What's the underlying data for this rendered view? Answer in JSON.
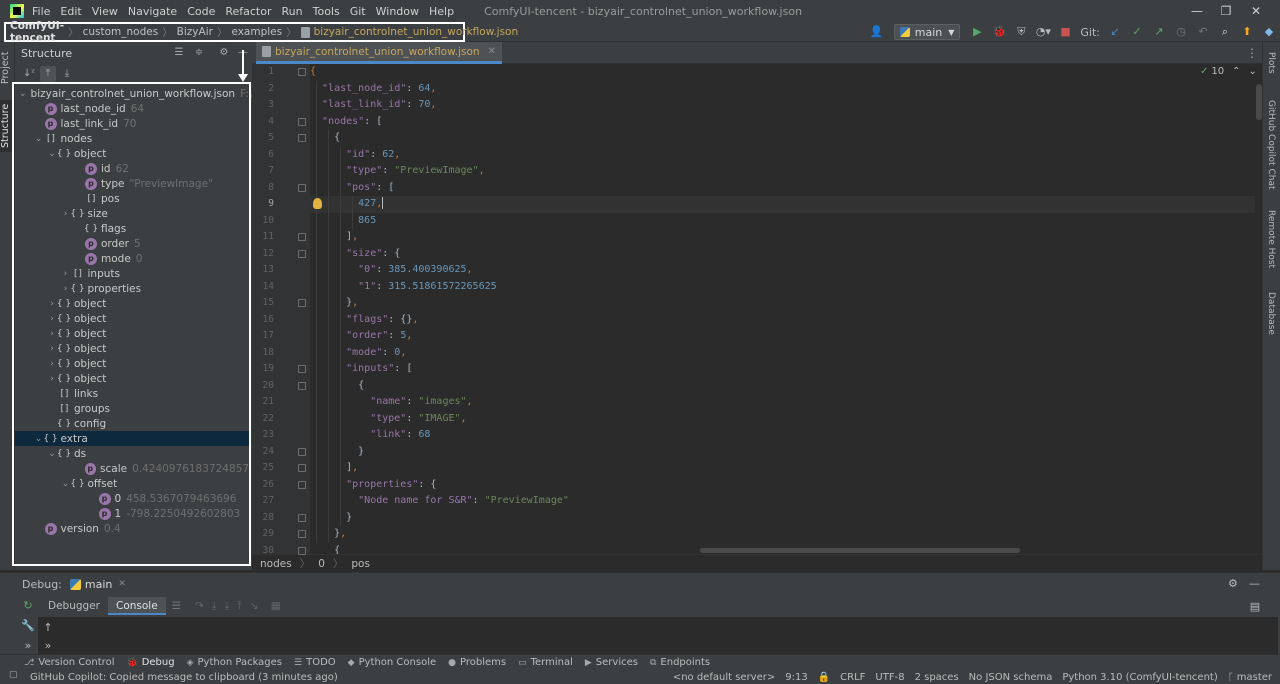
{
  "menu": [
    "File",
    "Edit",
    "View",
    "Navigate",
    "Code",
    "Refactor",
    "Run",
    "Tools",
    "Git",
    "Window",
    "Help"
  ],
  "window_title": "ComfyUI-tencent - bizyair_controlnet_union_workflow.json",
  "breadcrumbs": [
    "ComfyUI-tencent",
    "custom_nodes",
    "BizyAir",
    "examples",
    "bizyair_controlnet_union_workflow.json"
  ],
  "run_config": "main",
  "git_label": "Git:",
  "structure": {
    "title": "Structure",
    "tree": [
      {
        "label": "bizyair_controlnet_union_workflow.json",
        "value": "F:\\Con",
        "icon": "file",
        "chev": "v",
        "indent": 0
      },
      {
        "label": "last_node_id",
        "value": "64",
        "icon": "prop",
        "chev": "",
        "indent": 1
      },
      {
        "label": "last_link_id",
        "value": "70",
        "icon": "prop",
        "chev": "",
        "indent": 1
      },
      {
        "label": "nodes",
        "value": "",
        "icon": "arr",
        "chev": "v",
        "indent": 1
      },
      {
        "label": "object",
        "value": "",
        "icon": "obj",
        "chev": "v",
        "indent": 2
      },
      {
        "label": "id",
        "value": "62",
        "icon": "prop",
        "chev": "",
        "indent": 4
      },
      {
        "label": "type",
        "value": "\"PreviewImage\"",
        "icon": "prop",
        "chev": "",
        "indent": 4
      },
      {
        "label": "pos",
        "value": "",
        "icon": "arr",
        "chev": "",
        "indent": 4
      },
      {
        "label": "size",
        "value": "",
        "icon": "obj",
        "chev": ">",
        "indent": 3
      },
      {
        "label": "flags",
        "value": "",
        "icon": "obj",
        "chev": "",
        "indent": 4
      },
      {
        "label": "order",
        "value": "5",
        "icon": "prop",
        "chev": "",
        "indent": 4
      },
      {
        "label": "mode",
        "value": "0",
        "icon": "prop",
        "chev": "",
        "indent": 4
      },
      {
        "label": "inputs",
        "value": "",
        "icon": "arr",
        "chev": ">",
        "indent": 3
      },
      {
        "label": "properties",
        "value": "",
        "icon": "obj",
        "chev": ">",
        "indent": 3
      },
      {
        "label": "object",
        "value": "",
        "icon": "obj",
        "chev": ">",
        "indent": 2
      },
      {
        "label": "object",
        "value": "",
        "icon": "obj",
        "chev": ">",
        "indent": 2
      },
      {
        "label": "object",
        "value": "",
        "icon": "obj",
        "chev": ">",
        "indent": 2
      },
      {
        "label": "object",
        "value": "",
        "icon": "obj",
        "chev": ">",
        "indent": 2
      },
      {
        "label": "object",
        "value": "",
        "icon": "obj",
        "chev": ">",
        "indent": 2
      },
      {
        "label": "object",
        "value": "",
        "icon": "obj",
        "chev": ">",
        "indent": 2
      },
      {
        "label": "links",
        "value": "",
        "icon": "arr",
        "chev": "",
        "indent": 2
      },
      {
        "label": "groups",
        "value": "",
        "icon": "arr",
        "chev": "",
        "indent": 2
      },
      {
        "label": "config",
        "value": "",
        "icon": "obj",
        "chev": "",
        "indent": 2
      },
      {
        "label": "extra",
        "value": "",
        "icon": "obj",
        "chev": "v",
        "indent": 1,
        "selected": true
      },
      {
        "label": "ds",
        "value": "",
        "icon": "obj",
        "chev": "v",
        "indent": 2
      },
      {
        "label": "scale",
        "value": "0.4240976183724857",
        "icon": "prop",
        "chev": "",
        "indent": 4
      },
      {
        "label": "offset",
        "value": "",
        "icon": "obj",
        "chev": "v",
        "indent": 3
      },
      {
        "label": "0",
        "value": "458.5367079463696",
        "icon": "prop",
        "chev": "",
        "indent": 5
      },
      {
        "label": "1",
        "value": "-798.2250492602803",
        "icon": "prop",
        "chev": "",
        "indent": 5
      },
      {
        "label": "version",
        "value": "0.4",
        "icon": "prop",
        "chev": "",
        "indent": 1
      }
    ]
  },
  "editor": {
    "tab_label": "bizyair_controlnet_union_workflow.json",
    "inspection_count": "10",
    "current_line": 9,
    "lines": [
      {
        "n": "1",
        "indent": 0,
        "tokens": [
          [
            "p",
            "{"
          ]
        ]
      },
      {
        "n": "2",
        "indent": 1,
        "tokens": [
          [
            "k",
            "\"last_node_id\""
          ],
          [
            "t",
            ": "
          ],
          [
            "n",
            "64"
          ],
          [
            "p",
            ","
          ]
        ]
      },
      {
        "n": "3",
        "indent": 1,
        "tokens": [
          [
            "k",
            "\"last_link_id\""
          ],
          [
            "t",
            ": "
          ],
          [
            "n",
            "70"
          ],
          [
            "p",
            ","
          ]
        ]
      },
      {
        "n": "4",
        "indent": 1,
        "tokens": [
          [
            "k",
            "\"nodes\""
          ],
          [
            "t",
            ": ["
          ]
        ]
      },
      {
        "n": "5",
        "indent": 2,
        "tokens": [
          [
            "t",
            "{"
          ]
        ]
      },
      {
        "n": "6",
        "indent": 3,
        "tokens": [
          [
            "k",
            "\"id\""
          ],
          [
            "t",
            ": "
          ],
          [
            "n",
            "62"
          ],
          [
            "p",
            ","
          ]
        ]
      },
      {
        "n": "7",
        "indent": 3,
        "tokens": [
          [
            "k",
            "\"type\""
          ],
          [
            "t",
            ": "
          ],
          [
            "s",
            "\"PreviewImage\""
          ],
          [
            "p",
            ","
          ]
        ]
      },
      {
        "n": "8",
        "indent": 3,
        "tokens": [
          [
            "k",
            "\"pos\""
          ],
          [
            "t",
            ": ["
          ]
        ]
      },
      {
        "n": "9",
        "indent": 4,
        "tokens": [
          [
            "n",
            "427"
          ],
          [
            "p",
            ","
          ]
        ]
      },
      {
        "n": "10",
        "indent": 4,
        "tokens": [
          [
            "n",
            "865"
          ]
        ]
      },
      {
        "n": "11",
        "indent": 3,
        "tokens": [
          [
            "t",
            "]"
          ],
          [
            "p",
            ","
          ]
        ]
      },
      {
        "n": "12",
        "indent": 3,
        "tokens": [
          [
            "k",
            "\"size\""
          ],
          [
            "t",
            ": {"
          ]
        ]
      },
      {
        "n": "13",
        "indent": 4,
        "tokens": [
          [
            "k",
            "\"0\""
          ],
          [
            "t",
            ": "
          ],
          [
            "n",
            "385.400390625"
          ],
          [
            "p",
            ","
          ]
        ]
      },
      {
        "n": "14",
        "indent": 4,
        "tokens": [
          [
            "k",
            "\"1\""
          ],
          [
            "t",
            ": "
          ],
          [
            "n",
            "315.51861572265625"
          ]
        ]
      },
      {
        "n": "15",
        "indent": 3,
        "tokens": [
          [
            "t",
            "}"
          ],
          [
            "p",
            ","
          ]
        ]
      },
      {
        "n": "16",
        "indent": 3,
        "tokens": [
          [
            "k",
            "\"flags\""
          ],
          [
            "t",
            ": {}"
          ],
          [
            "p",
            ","
          ]
        ]
      },
      {
        "n": "17",
        "indent": 3,
        "tokens": [
          [
            "k",
            "\"order\""
          ],
          [
            "t",
            ": "
          ],
          [
            "n",
            "5"
          ],
          [
            "p",
            ","
          ]
        ]
      },
      {
        "n": "18",
        "indent": 3,
        "tokens": [
          [
            "k",
            "\"mode\""
          ],
          [
            "t",
            ": "
          ],
          [
            "n",
            "0"
          ],
          [
            "p",
            ","
          ]
        ]
      },
      {
        "n": "19",
        "indent": 3,
        "tokens": [
          [
            "k",
            "\"inputs\""
          ],
          [
            "t",
            ": ["
          ]
        ]
      },
      {
        "n": "20",
        "indent": 4,
        "tokens": [
          [
            "t",
            "{"
          ]
        ]
      },
      {
        "n": "21",
        "indent": 5,
        "tokens": [
          [
            "k",
            "\"name\""
          ],
          [
            "t",
            ": "
          ],
          [
            "s",
            "\"images\""
          ],
          [
            "p",
            ","
          ]
        ]
      },
      {
        "n": "22",
        "indent": 5,
        "tokens": [
          [
            "k",
            "\"type\""
          ],
          [
            "t",
            ": "
          ],
          [
            "s",
            "\"IMAGE\""
          ],
          [
            "p",
            ","
          ]
        ]
      },
      {
        "n": "23",
        "indent": 5,
        "tokens": [
          [
            "k",
            "\"link\""
          ],
          [
            "t",
            ": "
          ],
          [
            "n",
            "68"
          ]
        ]
      },
      {
        "n": "24",
        "indent": 4,
        "tokens": [
          [
            "t",
            "}"
          ]
        ]
      },
      {
        "n": "25",
        "indent": 3,
        "tokens": [
          [
            "t",
            "]"
          ],
          [
            "p",
            ","
          ]
        ]
      },
      {
        "n": "26",
        "indent": 3,
        "tokens": [
          [
            "k",
            "\"properties\""
          ],
          [
            "t",
            ": {"
          ]
        ]
      },
      {
        "n": "27",
        "indent": 4,
        "tokens": [
          [
            "k",
            "\"Node name for S&R\""
          ],
          [
            "t",
            ": "
          ],
          [
            "s",
            "\"PreviewImage\""
          ]
        ]
      },
      {
        "n": "28",
        "indent": 3,
        "tokens": [
          [
            "t",
            "}"
          ]
        ]
      },
      {
        "n": "29",
        "indent": 2,
        "tokens": [
          [
            "t",
            "}"
          ],
          [
            "p",
            ","
          ]
        ]
      },
      {
        "n": "30",
        "indent": 2,
        "tokens": [
          [
            "t",
            "{"
          ]
        ]
      }
    ],
    "breadcrumb": [
      "nodes",
      "0",
      "pos"
    ]
  },
  "left_tabs": {
    "project": "Project",
    "structure": "Structure"
  },
  "right_tabs": {
    "plots": "Plots",
    "copilot": "GitHub Copilot Chat",
    "remote": "Remote Host",
    "database": "Database"
  },
  "debug": {
    "title": "Debug:",
    "tab": "main",
    "subtabs": [
      "Debugger",
      "Console"
    ]
  },
  "tool_windows": [
    {
      "label": "Version Control",
      "icon": "vcs-icon"
    },
    {
      "label": "Debug",
      "icon": "bug-icon",
      "active": true
    },
    {
      "label": "Python Packages",
      "icon": "packages-icon"
    },
    {
      "label": "TODO",
      "icon": "list-icon"
    },
    {
      "label": "Python Console",
      "icon": "python-icon"
    },
    {
      "label": "Problems",
      "icon": "info-icon"
    },
    {
      "label": "Terminal",
      "icon": "terminal-icon"
    },
    {
      "label": "Services",
      "icon": "services-icon"
    },
    {
      "label": "Endpoints",
      "icon": "endpoints-icon"
    }
  ],
  "status": {
    "message": "GitHub Copilot: Copied message to clipboard (3 minutes ago)",
    "server": "<no default server>",
    "position": "9:13",
    "line_sep": "CRLF",
    "encoding": "UTF-8",
    "indent": "2 spaces",
    "schema": "No JSON schema",
    "interpreter": "Python 3.10 (ComfyUI-tencent)",
    "branch": "master"
  },
  "colors": {
    "keyword": "#9876aa",
    "string": "#6a8759",
    "number": "#6897bb",
    "punct": "#cc7832",
    "selection": "#0d293e",
    "tab_accent": "#4a88c7"
  }
}
